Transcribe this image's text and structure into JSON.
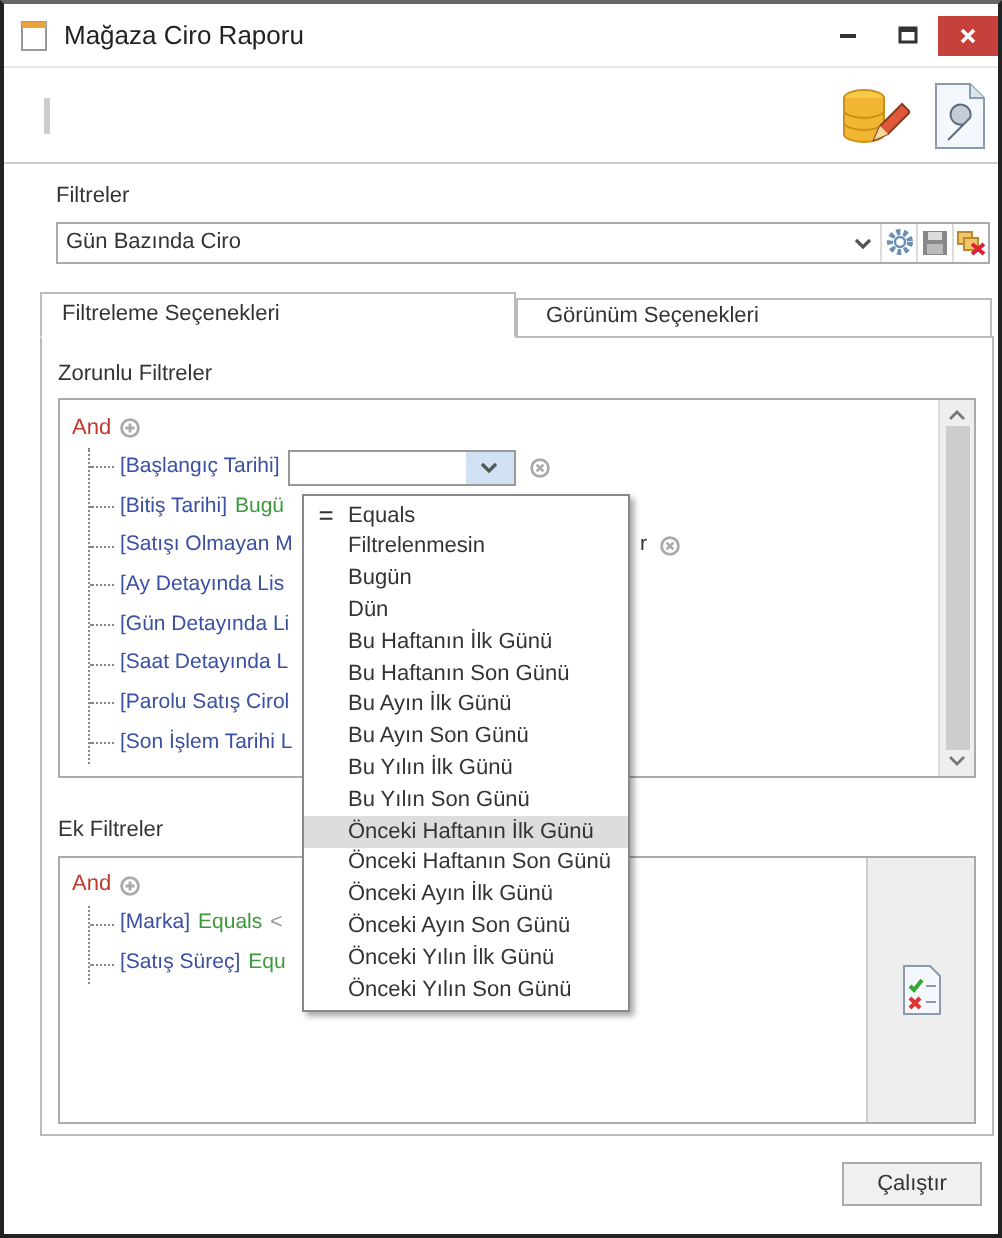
{
  "window": {
    "title": "Mağaza Ciro Raporu"
  },
  "filters": {
    "label": "Filtreler",
    "value": "Gün Bazında Ciro"
  },
  "tabs": [
    {
      "label": "Filtreleme Seçenekleri",
      "selected": true
    },
    {
      "label": "Görünüm Seçenekleri",
      "selected": false
    }
  ],
  "required_filters": {
    "label": "Zorunlu Filtreler",
    "operator": "And",
    "items": [
      {
        "kind": "editor",
        "field": "[Başlangıç Tarihi]"
      },
      {
        "kind": "text",
        "field": "[Bitiş Tarihi]",
        "value": "Bugü"
      },
      {
        "kind": "text",
        "field": "[Satışı Olmayan M",
        "tail": "r"
      },
      {
        "kind": "text",
        "field": "[Ay Detayında Lis"
      },
      {
        "kind": "text",
        "field": "[Gün Detayında Li"
      },
      {
        "kind": "text",
        "field": "[Saat Detayında L"
      },
      {
        "kind": "text",
        "field": "[Parolu Satış Cirol"
      },
      {
        "kind": "text",
        "field": "[Son İşlem Tarihi L"
      }
    ]
  },
  "dropdown": {
    "items": [
      {
        "label": "Equals",
        "marker": "=",
        "selected": false
      },
      {
        "label": "Filtrelenmesin",
        "selected": false
      },
      {
        "label": "Bugün",
        "selected": false
      },
      {
        "label": "Dün",
        "selected": false
      },
      {
        "label": "Bu Haftanın İlk Günü",
        "selected": false
      },
      {
        "label": "Bu Haftanın Son Günü",
        "selected": false
      },
      {
        "label": "Bu Ayın İlk Günü",
        "selected": false
      },
      {
        "label": "Bu Ayın Son Günü",
        "selected": false
      },
      {
        "label": "Bu Yılın İlk Günü",
        "selected": false
      },
      {
        "label": "Bu Yılın Son Günü",
        "selected": false
      },
      {
        "label": "Önceki Haftanın İlk Günü",
        "selected": true
      },
      {
        "label": "Önceki Haftanın Son Günü",
        "selected": false
      },
      {
        "label": "Önceki Ayın İlk Günü",
        "selected": false
      },
      {
        "label": "Önceki Ayın Son Günü",
        "selected": false
      },
      {
        "label": "Önceki Yılın İlk Günü",
        "selected": false
      },
      {
        "label": "Önceki Yılın Son Günü",
        "selected": false
      }
    ]
  },
  "extra_filters": {
    "label": "Ek Filtreler",
    "operator": "And",
    "items": [
      {
        "field": "[Marka]",
        "operator": "Equals",
        "value": "<"
      },
      {
        "field": "[Satış Süreç]",
        "operator": "Equ"
      }
    ]
  },
  "buttons": [
    {
      "label": "Çalıştır"
    }
  ]
}
